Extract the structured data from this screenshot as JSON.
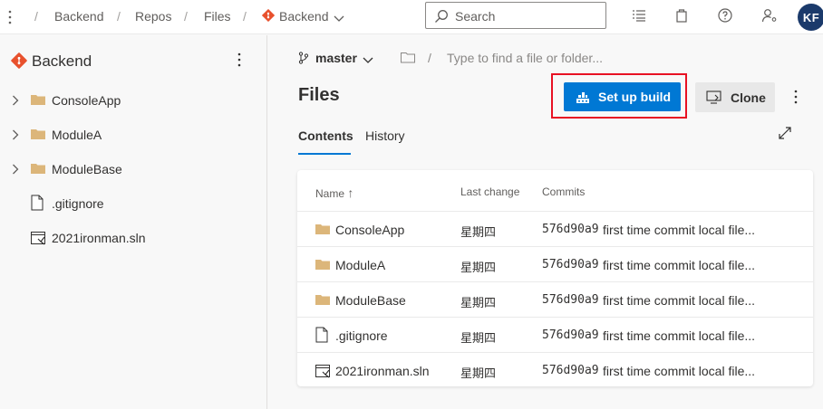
{
  "topbar": {
    "breadcrumbs": [
      "Backend",
      "Repos",
      "Files",
      "Backend"
    ],
    "search_placeholder": "Search",
    "avatar_initials": "KF"
  },
  "sidebar": {
    "repo_name": "Backend",
    "items": [
      {
        "label": "ConsoleApp",
        "type": "folder"
      },
      {
        "label": "ModuleA",
        "type": "folder"
      },
      {
        "label": "ModuleBase",
        "type": "folder"
      },
      {
        "label": ".gitignore",
        "type": "file"
      },
      {
        "label": "2021ironman.sln",
        "type": "solution"
      }
    ]
  },
  "main": {
    "branch": "master",
    "path_placeholder": "Type to find a file or folder...",
    "title": "Files",
    "setup_build_label": "Set up build",
    "clone_label": "Clone",
    "tabs": [
      {
        "label": "Contents",
        "active": true
      },
      {
        "label": "History",
        "active": false
      }
    ],
    "table": {
      "columns": [
        "Name",
        "Last change",
        "Commits"
      ],
      "sort_indicator": "↑",
      "rows": [
        {
          "name": "ConsoleApp",
          "type": "folder",
          "last_change": "星期四",
          "commit": "576d90a9",
          "message": "first time commit local file..."
        },
        {
          "name": "ModuleA",
          "type": "folder",
          "last_change": "星期四",
          "commit": "576d90a9",
          "message": "first time commit local file..."
        },
        {
          "name": "ModuleBase",
          "type": "folder",
          "last_change": "星期四",
          "commit": "576d90a9",
          "message": "first time commit local file..."
        },
        {
          "name": ".gitignore",
          "type": "file",
          "last_change": "星期四",
          "commit": "576d90a9",
          "message": "first time commit local file..."
        },
        {
          "name": "2021ironman.sln",
          "type": "solution",
          "last_change": "星期四",
          "commit": "576d90a9",
          "message": "first time commit local file..."
        }
      ]
    }
  },
  "colors": {
    "accent": "#0078d4",
    "highlight_outline": "#e81123",
    "folder": "#dcb67a",
    "repo_logo": "#e8512d"
  }
}
